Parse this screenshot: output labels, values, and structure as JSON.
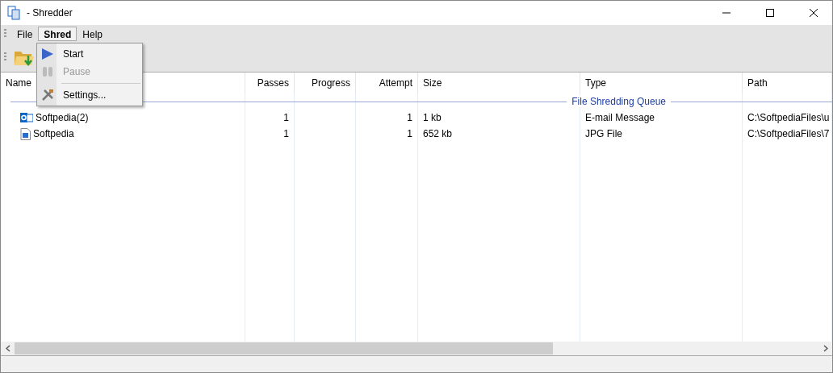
{
  "window": {
    "title": "- Shredder"
  },
  "menu_bar": [
    {
      "label": "File",
      "selected": false
    },
    {
      "label": "Shred",
      "selected": true
    },
    {
      "label": "Help",
      "selected": false
    }
  ],
  "dropdown": [
    {
      "label": "Start",
      "disabled": false
    },
    {
      "label": "Pause",
      "disabled": true
    },
    {
      "label": "Settings...",
      "disabled": false
    }
  ],
  "table": {
    "columns": [
      "Name",
      "Passes",
      "Progress",
      "Attempt",
      "Size",
      "Type",
      "Path"
    ],
    "group": "File Shredding Queue",
    "rows": [
      {
        "cells": [
          "Softpedia(2)",
          "1",
          "",
          "1",
          "1 kb",
          "E-mail Message",
          "C:\\SoftpediaFiles\\u"
        ]
      },
      {
        "cells": [
          "Softpedia",
          "1",
          "",
          "1",
          "652 kb",
          "JPG File",
          "C:\\SoftpediaFiles\\7"
        ]
      }
    ]
  }
}
